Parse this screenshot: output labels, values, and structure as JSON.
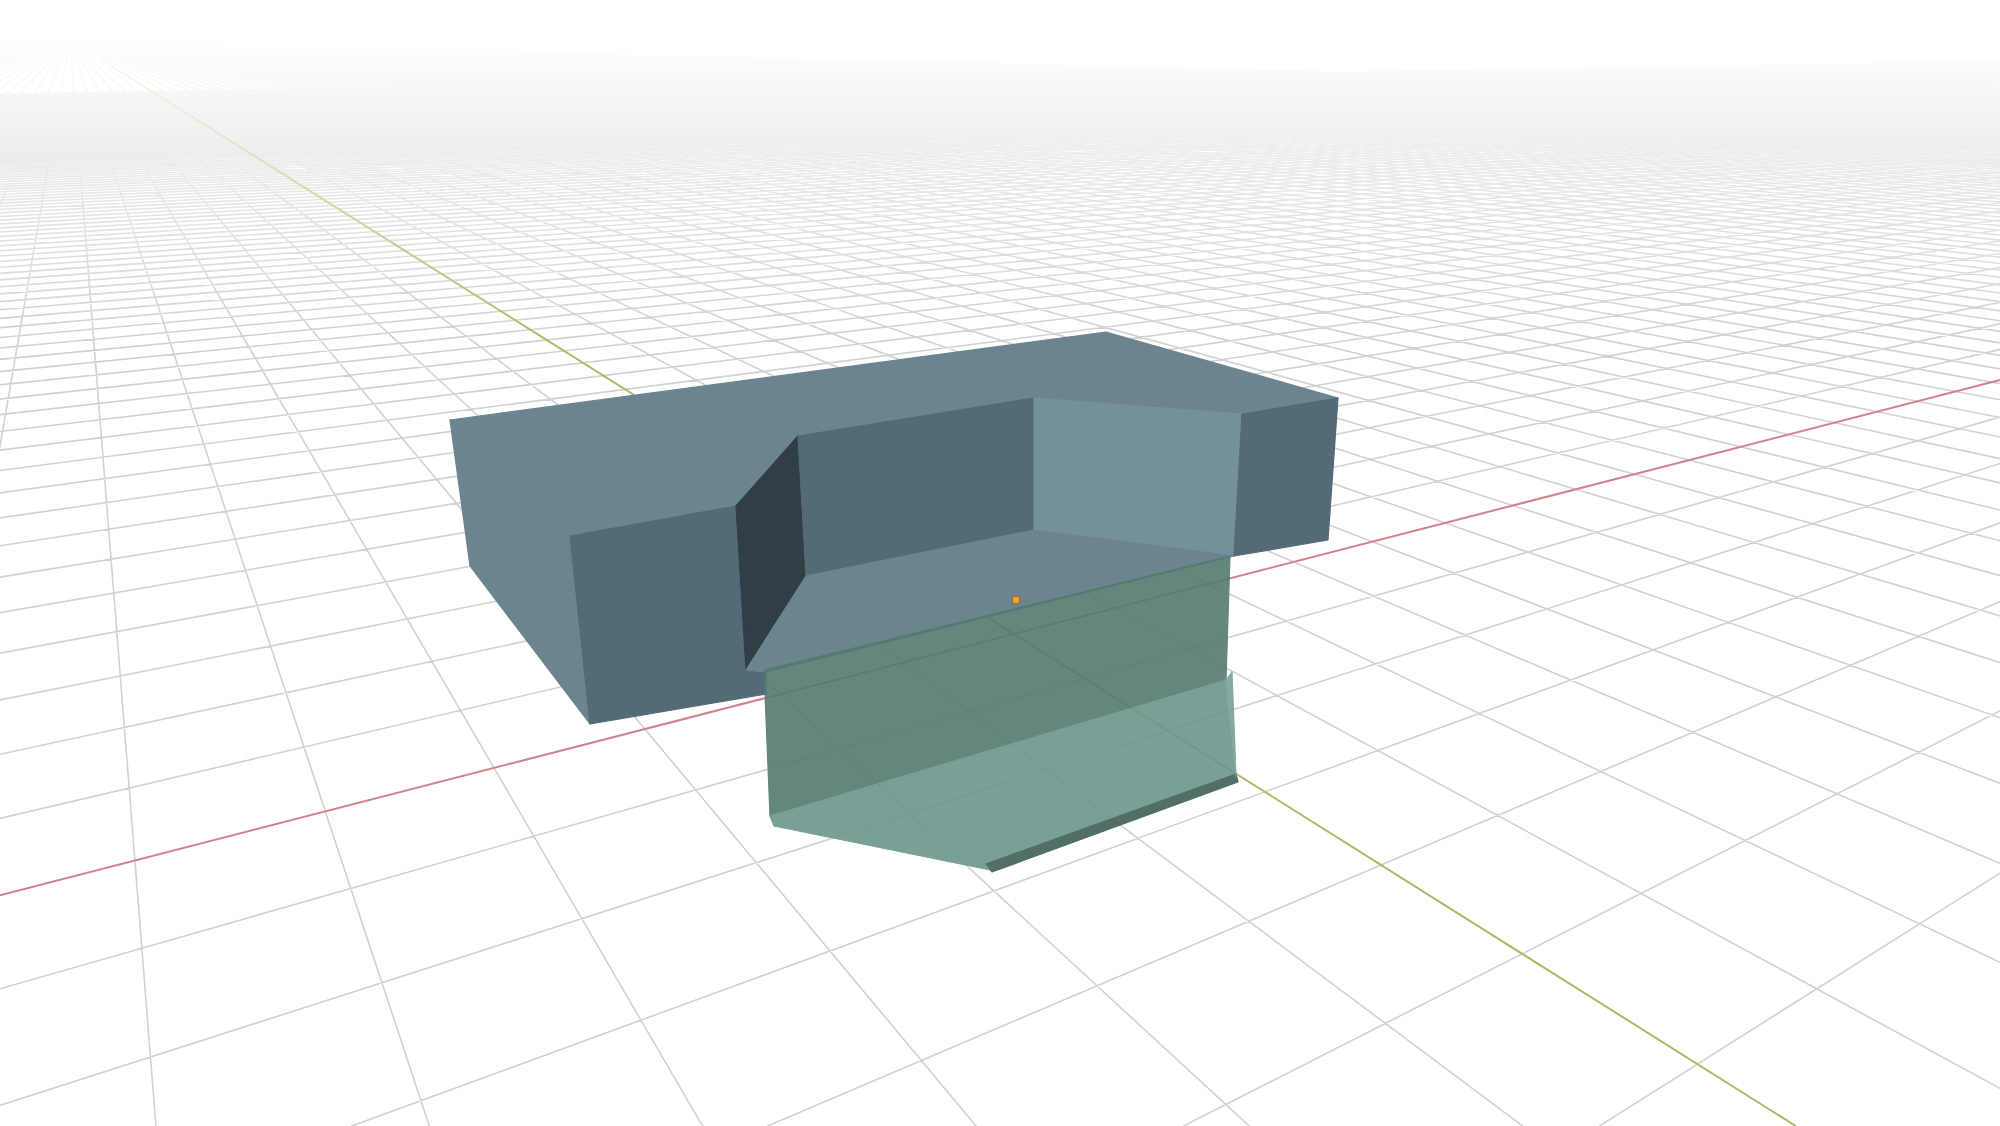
{
  "scene": {
    "objects": [
      {
        "kind": "block",
        "selected": false
      },
      {
        "kind": "bracket",
        "selected": true
      }
    ]
  }
}
